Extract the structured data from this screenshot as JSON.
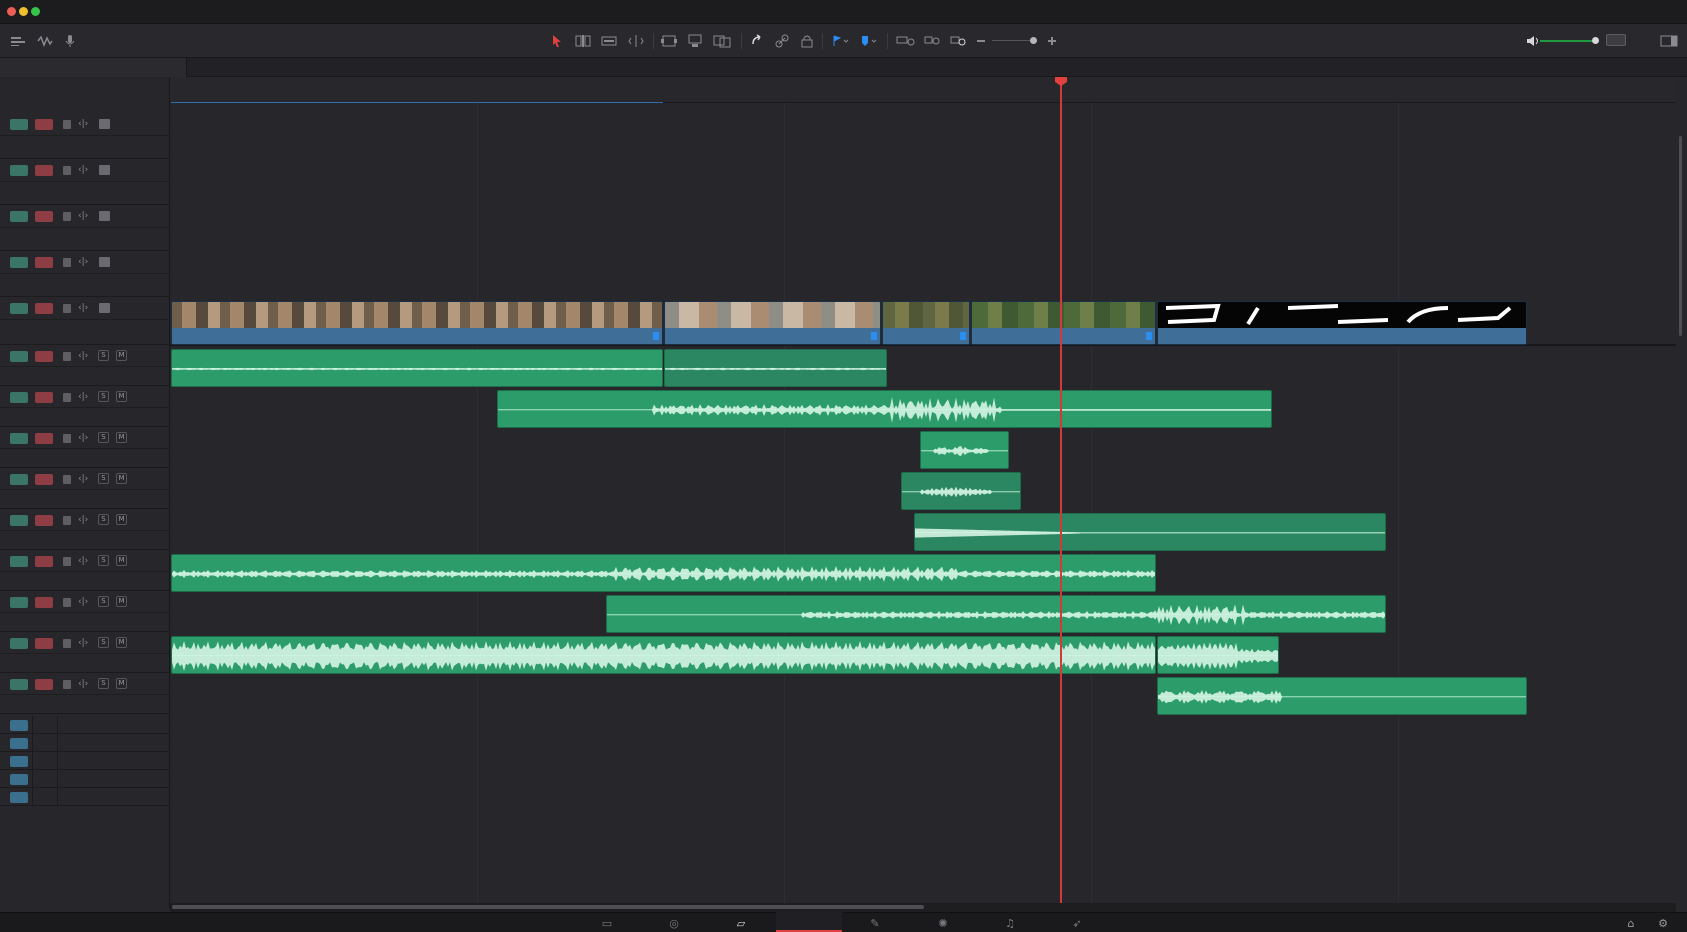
{
  "window": {
    "traffic_lights": [
      "close",
      "minimize",
      "zoom"
    ]
  },
  "toolbar": {
    "left_icons": [
      "timeline-view-options-icon",
      "audio-waveform-icon",
      "voiceover-mic-icon"
    ],
    "edit_tools": [
      "selection-mode-icon",
      "trim-edit-mode-icon",
      "dynamic-trim-icon",
      "blade-edit-icon"
    ],
    "edit_actions": [
      "insert-clip-icon",
      "overwrite-clip-icon",
      "replace-clip-icon"
    ],
    "snap_link": [
      "snapping-icon",
      "linked-selection-icon",
      "position-lock-icon"
    ],
    "markers": [
      "flag-icon",
      "marker-icon"
    ],
    "zoom": [
      "full-extent-zoom-icon",
      "detail-zoom-icon",
      "custom-zoom-icon",
      "zoom-out-icon",
      "zoom-in-icon"
    ],
    "right_icons": [
      "speaker-icon",
      "audio-meter-icon",
      "inspector-toggle-icon"
    ],
    "volume_level": 0.9
  },
  "track_groups": {
    "video_track_count": 5,
    "audio_track_count": 9,
    "empty_track_count": 5
  },
  "audio_track_buttons": {
    "solo": "S",
    "mute": "M"
  },
  "page_tabs": {
    "items": [
      "media-page-icon",
      "cut-page-icon",
      "edit-page-icon",
      "fusion-page-icon",
      "color-page-icon",
      "fairlight-page-icon",
      "deliver-page-icon"
    ],
    "active": "edit-page-icon"
  },
  "colors": {
    "accent": "#e0413e",
    "video_clip": "#3f6e98",
    "audio_clip": "#2c9c6b",
    "marker": "#2b8cf2"
  }
}
